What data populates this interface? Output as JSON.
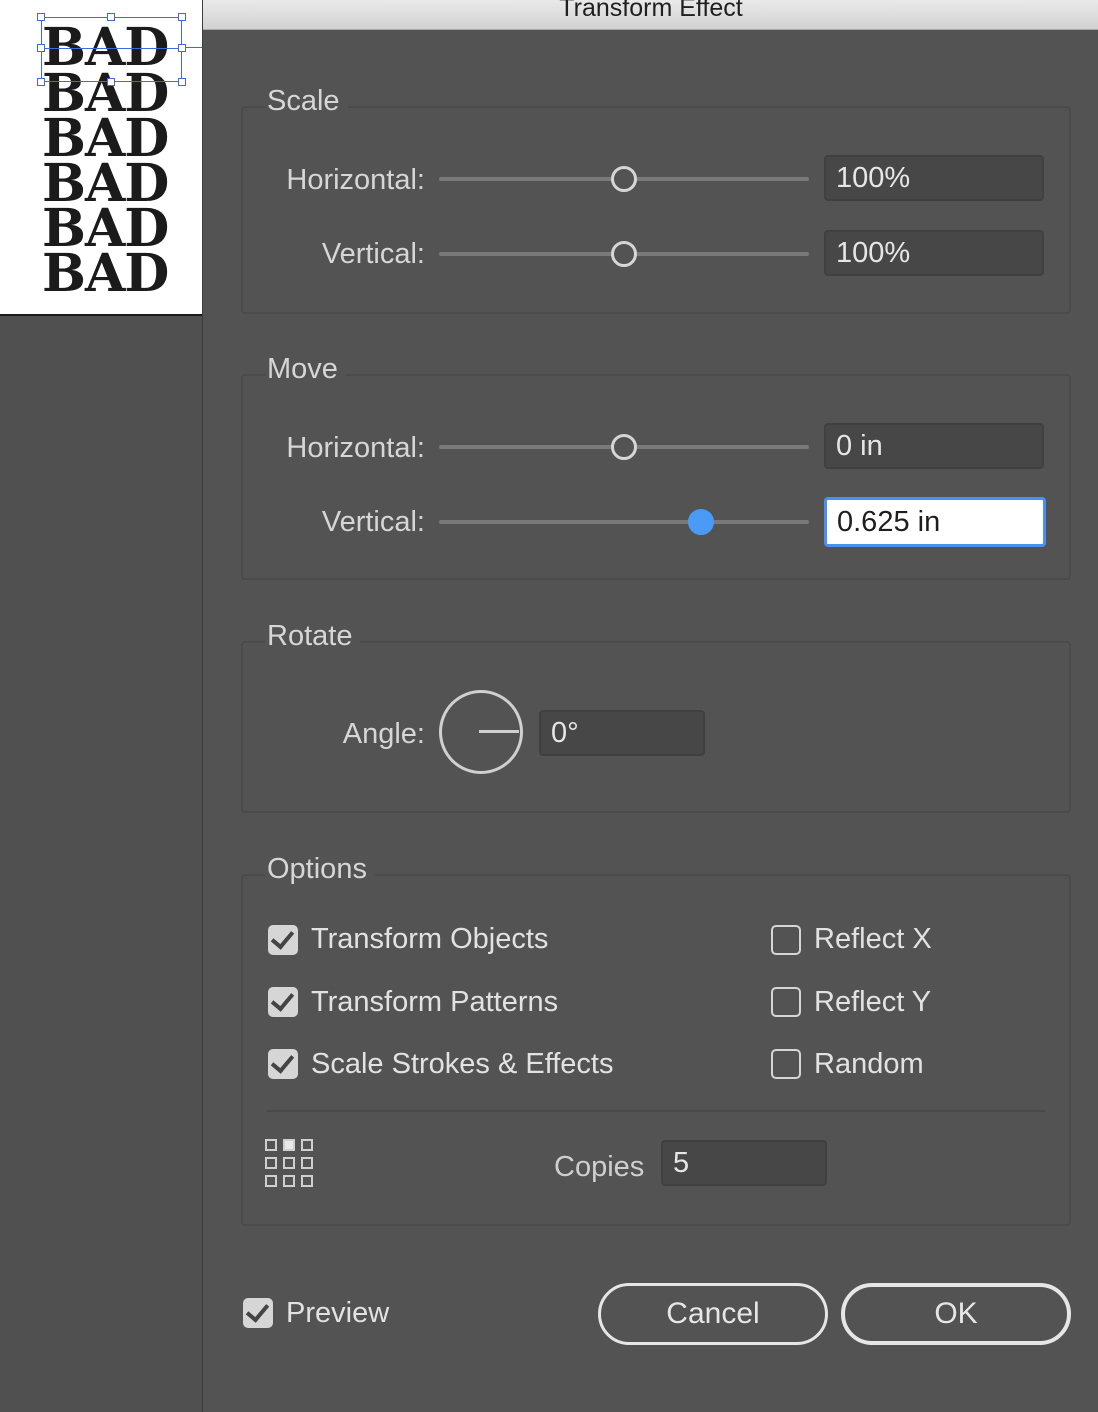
{
  "canvas": {
    "artwork_words": [
      "BAD",
      "BAD",
      "BAD",
      "BAD",
      "BAD",
      "BAD"
    ]
  },
  "dialog": {
    "title": "Transform Effect",
    "scale": {
      "title": "Scale",
      "horizontal_label": "Horizontal:",
      "horizontal_value": "100%",
      "vertical_label": "Vertical:",
      "vertical_value": "100%"
    },
    "move": {
      "title": "Move",
      "horizontal_label": "Horizontal:",
      "horizontal_value": "0 in",
      "vertical_label": "Vertical:",
      "vertical_value": "0.625 in"
    },
    "rotate": {
      "title": "Rotate",
      "angle_label": "Angle:",
      "angle_value": "0°"
    },
    "options": {
      "title": "Options",
      "transform_objects": {
        "label": "Transform Objects",
        "checked": true
      },
      "transform_patterns": {
        "label": "Transform Patterns",
        "checked": true
      },
      "scale_strokes": {
        "label": "Scale Strokes & Effects",
        "checked": true
      },
      "reflect_x": {
        "label": "Reflect X",
        "checked": false
      },
      "reflect_y": {
        "label": "Reflect Y",
        "checked": false
      },
      "random": {
        "label": "Random",
        "checked": false
      },
      "copies_label": "Copies",
      "copies_value": "5"
    },
    "preview": {
      "label": "Preview",
      "checked": true
    },
    "cancel_label": "Cancel",
    "ok_label": "OK"
  },
  "colors": {
    "dialog_bg": "#535353",
    "accent": "#4a9bf5",
    "text": "#d6d6d6"
  }
}
